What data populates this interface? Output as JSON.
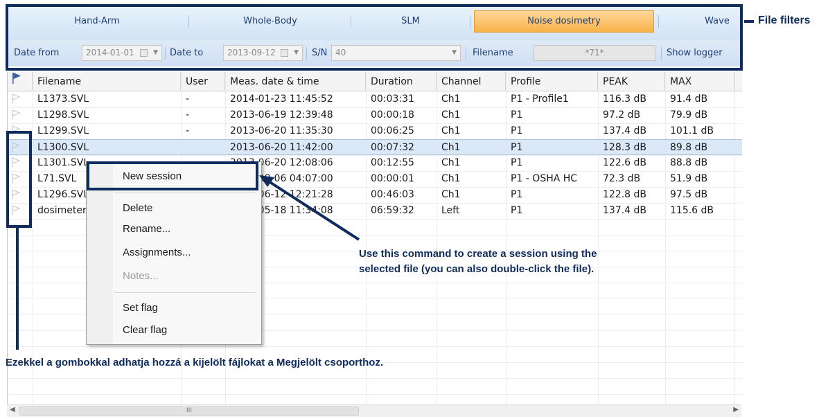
{
  "tabs": [
    {
      "label": "Hand-Arm"
    },
    {
      "label": "Whole-Body"
    },
    {
      "label": "SLM"
    },
    {
      "label": "Noise dosimetry",
      "active": true
    },
    {
      "label": "Wave"
    }
  ],
  "filters": {
    "date_from_label": "Date from",
    "date_from_value": "2014-01-01",
    "date_to_label": "Date to",
    "date_to_value": "2013-09-12",
    "sn_label": "S/N",
    "sn_value": "40",
    "filename_label": "Filename",
    "filename_value": "*71*",
    "show_logger_label": "Show logger"
  },
  "table": {
    "columns": [
      "Filename",
      "User",
      "Meas. date & time",
      "Duration",
      "Channel",
      "Profile",
      "PEAK",
      "MAX"
    ],
    "rows": [
      [
        "L1373.SVL",
        "-",
        "2014-01-23 11:45:52",
        "00:03:31",
        "Ch1",
        "P1 - Profile1",
        "116.3 dB",
        "91.4 dB"
      ],
      [
        "L1298.SVL",
        "-",
        "2013-06-19 12:39:48",
        "00:00:18",
        "Ch1",
        "P1",
        "97.2 dB",
        "79.9 dB"
      ],
      [
        "L1299.SVL",
        "-",
        "2013-06-20 11:35:30",
        "00:06:25",
        "Ch1",
        "P1",
        "137.4 dB",
        "101.1 dB"
      ],
      [
        "L1300.SVL",
        "",
        "2013-06-20 11:42:00",
        "00:07:32",
        "Ch1",
        "P1",
        "128.3 dB",
        "89.8 dB"
      ],
      [
        "L1301.SVL",
        "",
        "2013-06-20 12:08:06",
        "00:12:55",
        "Ch1",
        "P1",
        "122.6 dB",
        "88.8 dB"
      ],
      [
        "L71.SVL",
        "",
        "2013-08-06 04:07:00",
        "00:00:01",
        "Ch1",
        "P1 - OSHA HC",
        "72.3 dB",
        "51.9 dB"
      ],
      [
        "L1296.SVL",
        "",
        "2013-06-12 12:21:28",
        "00:46:03",
        "Ch1",
        "P1",
        "122.8 dB",
        "97.5 dB"
      ],
      [
        "dosimeter",
        "",
        "2011-05-18 11:34:08",
        "06:59:32",
        "Left",
        "P1",
        "137.4 dB",
        "115.6 dB"
      ]
    ],
    "selected_row": 3
  },
  "context_menu": {
    "new_session": "New session",
    "delete": "Delete",
    "rename": "Rename...",
    "assignments": "Assignments...",
    "notes": "Notes...",
    "set_flag": "Set flag",
    "clear_flag": "Clear flag"
  },
  "scrollbar": {
    "grip": "III"
  },
  "annotations": {
    "file_filters": "File filters",
    "new_session_hint_line1": "Use this command to create a session using the",
    "new_session_hint_line2": "selected file (you can also double-click the file).",
    "flag_hint": "Ezekkel a gombokkal adhatja hozzá a kijelölt fájlokat a Megjelölt csoporthoz."
  },
  "colors": {
    "annotation": "#0f2c5c",
    "active_tab": "#f9b149",
    "selection": "#dbe8f8"
  }
}
